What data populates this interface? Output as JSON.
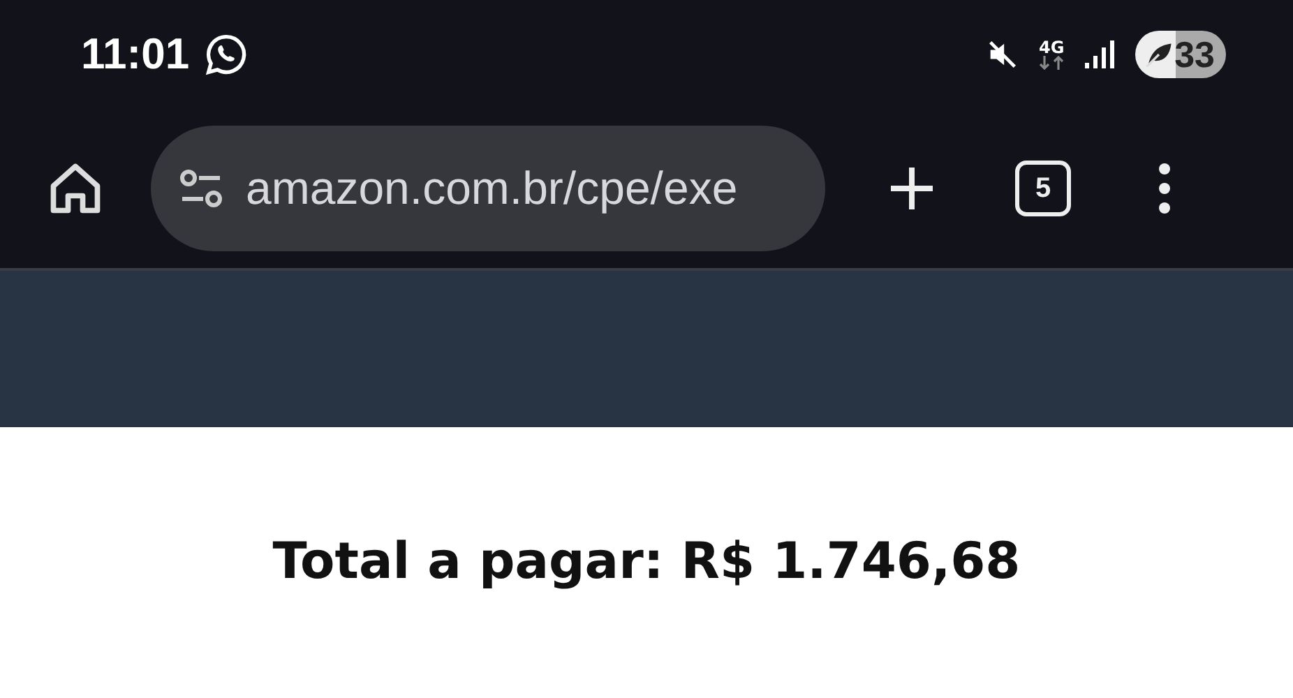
{
  "status_bar": {
    "time": "11:01",
    "network": "4G",
    "battery": "33"
  },
  "browser_toolbar": {
    "url": "amazon.com.br/cpe/exe",
    "tab_count": "5"
  },
  "page": {
    "total": "Total a pagar: R$ 1.746,68"
  }
}
